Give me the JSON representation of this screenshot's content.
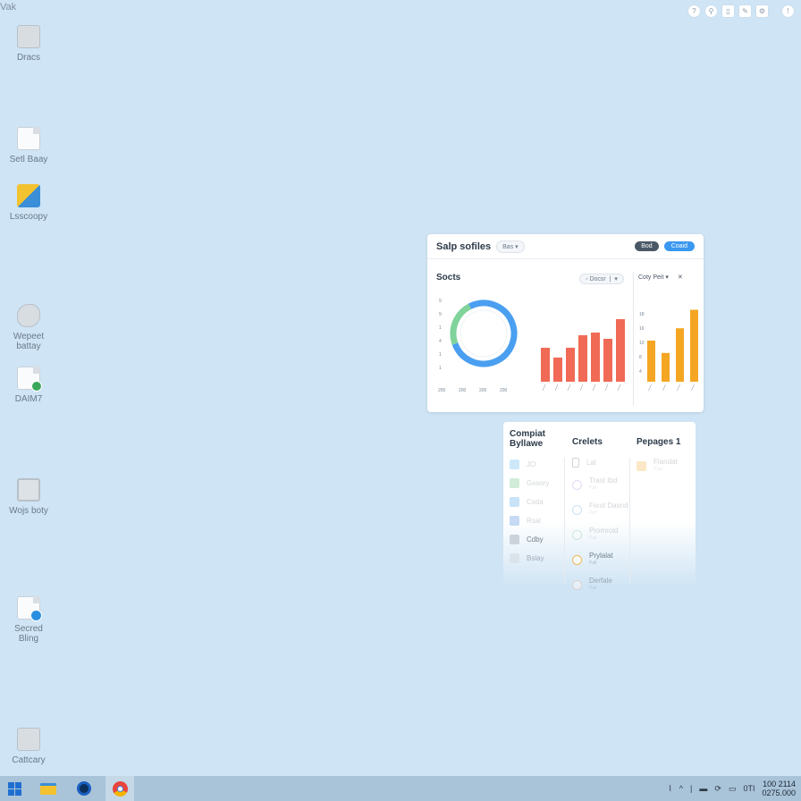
{
  "corner_label": "Vak",
  "desktop_icons": [
    {
      "label": "Dracs",
      "icon": "document-icon"
    },
    {
      "label": "Setl Baay",
      "icon": "file-icon"
    },
    {
      "label": "Lsscoopy",
      "icon": "folder-icon"
    },
    {
      "label": "Wepeet battay",
      "icon": "app-icon"
    },
    {
      "label": "DAIM7",
      "icon": "spreadsheet-icon"
    },
    {
      "label": "Wojs boty",
      "icon": "settings-icon"
    },
    {
      "label": "Secred Bling",
      "icon": "document-icon"
    },
    {
      "label": "Cattcary",
      "icon": "file-icon"
    }
  ],
  "card": {
    "title": "Salp sofiles",
    "title_pill": "Bas",
    "btn_dark": "Bod",
    "btn_blue": "Coaid",
    "section": "Socts",
    "section_filter": "Docsr",
    "right_filter": "Coty Peit",
    "right_extra": "✕",
    "ring_yticks": [
      "9",
      "9",
      "1",
      "4",
      "1",
      "1"
    ],
    "ring_xticks": [
      "200",
      "200",
      "200",
      "200"
    ],
    "right_yticks": [
      "18",
      "16",
      "10",
      "8",
      "4"
    ]
  },
  "chart_data": [
    {
      "type": "pie",
      "values": [
        23,
        77
      ],
      "colors": [
        "#7fd39b",
        "#4a9ff0"
      ]
    },
    {
      "type": "bar",
      "values": [
        38,
        27,
        38,
        52,
        55,
        48,
        70
      ],
      "ylim": [
        0,
        100
      ],
      "color": "#f06a55"
    },
    {
      "type": "bar",
      "values": [
        40,
        28,
        52,
        70
      ],
      "ylim": [
        0,
        80
      ],
      "color": "#f4a623"
    }
  ],
  "panel": {
    "col1": {
      "title": "Compiat Byllawe",
      "items": [
        {
          "label": "JO",
          "color": "#3aa8e8"
        },
        {
          "label": "Gssory",
          "color": "#4ab86a"
        },
        {
          "label": "Csda",
          "color": "#2a8fe0"
        },
        {
          "label": "Rsal",
          "color": "#2070d0"
        },
        {
          "label": "Cdby",
          "color": "#c0c8d0"
        },
        {
          "label": "Bslay",
          "color": "#d0d6dc"
        }
      ]
    },
    "col2": {
      "title": "Crelets",
      "items": [
        {
          "label": "Lal",
          "sub": "",
          "color": "#4a5866"
        },
        {
          "label": "Trast Ibd",
          "sub": "Pall",
          "color": "#9a6ad8"
        },
        {
          "label": "Fsrot Dasnd",
          "sub": "Pafl",
          "color": "#2a8fe0"
        },
        {
          "label": "Promrold",
          "sub": "Pall",
          "color": "#4ab86a"
        },
        {
          "label": "Prylalat",
          "sub": "Pall",
          "color": "#f4a623"
        },
        {
          "label": "Derfale",
          "sub": "Pall",
          "color": "#f0b8a0"
        }
      ]
    },
    "col3": {
      "title": "Pepages 1",
      "items": [
        {
          "label": "Flandat",
          "sub": "Pual",
          "color": "#f4a623"
        }
      ]
    }
  },
  "tray": {
    "sys": "0TI",
    "time": "100 2114",
    "date": "0275.000"
  }
}
